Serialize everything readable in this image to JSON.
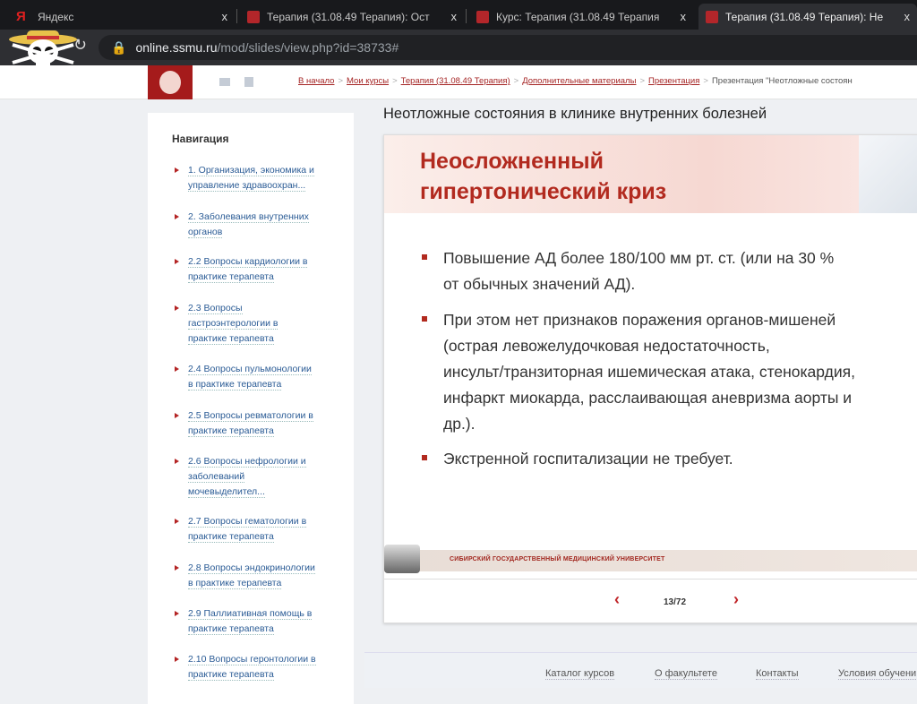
{
  "browser": {
    "tabs": [
      {
        "title": "Яндекс",
        "icon": "yandex-icon"
      },
      {
        "title": "Терапия (31.08.49 Терапия): Ост",
        "icon": "ssmu-icon"
      },
      {
        "title": "Курс: Терапия (31.08.49 Терапия",
        "icon": "ssmu-icon"
      },
      {
        "title": "Терапия (31.08.49 Терапия): Не",
        "icon": "ssmu-icon",
        "active": true
      }
    ],
    "close_label": "x",
    "url_host": "online.ssmu.ru",
    "url_path": "/mod/slides/view.php?id=38733#"
  },
  "breadcrumbs": [
    "В начало",
    "Мои курсы",
    "Терапия (31.08.49 Терапия)",
    "Дополнительные материалы",
    "Презентация",
    "Презентация \"Неотложные состоян"
  ],
  "breadcrumb_sep": ">",
  "sidebar": {
    "title": "Навигация",
    "items": [
      [
        "1. Организация, экономика и",
        "управление здравоохран..."
      ],
      [
        "2. Заболевания внутренних",
        "органов"
      ],
      [
        "2.2 Вопросы кардиологии в",
        "практике терапевта"
      ],
      [
        "2.3 Вопросы",
        "гастроэнтерологии в",
        "практике терапевта"
      ],
      [
        "2.4 Вопросы пульмонологии",
        "в практике терапевта"
      ],
      [
        "2.5 Вопросы ревматологии в",
        "практике терапевта"
      ],
      [
        "2.6 Вопросы нефрологии и",
        "заболеваний",
        "мочевыделител..."
      ],
      [
        "2.7 Вопросы гематологии в",
        "практике терапевта"
      ],
      [
        "2.8 Вопросы эндокринологии",
        "в практике терапевта"
      ],
      [
        "2.9 Паллиативная помощь в",
        "практике терапевта"
      ],
      [
        "2.10 Вопросы геронтологии в",
        "практике терапевта"
      ]
    ]
  },
  "main": {
    "title": "Неотложные состояния в клинике внутренних болезней",
    "slide": {
      "heading": [
        "Неосложненный",
        "гипертонический криз"
      ],
      "bullets": [
        [
          "Повышение АД более 180/100 мм рт. ст. (или на 30 %",
          "от обычных значений АД)."
        ],
        [
          "При этом нет признаков поражения органов-мишеней",
          "(острая левожелудочковая недостаточность,",
          "инсульт/транзиторная ишемическая атака, стенокардия,",
          "инфаркт миокарда, расслаивающая аневризма аорты и",
          "др.)."
        ],
        [
          "Экстренной госпитализации не требует."
        ]
      ],
      "footer": "СИБИРСКИЙ ГОСУДАРСТВЕННЫЙ МЕДИЦИНСКИЙ УНИВЕРСИТЕТ"
    },
    "pager": {
      "prev": "‹",
      "next": "›",
      "current": 13,
      "total": 72,
      "label": "13/72"
    }
  },
  "footer": [
    "Каталог курсов",
    "О факультете",
    "Контакты",
    "Условия обучени"
  ],
  "colors": {
    "accent": "#b22a1f",
    "link": "#2a5b95"
  }
}
